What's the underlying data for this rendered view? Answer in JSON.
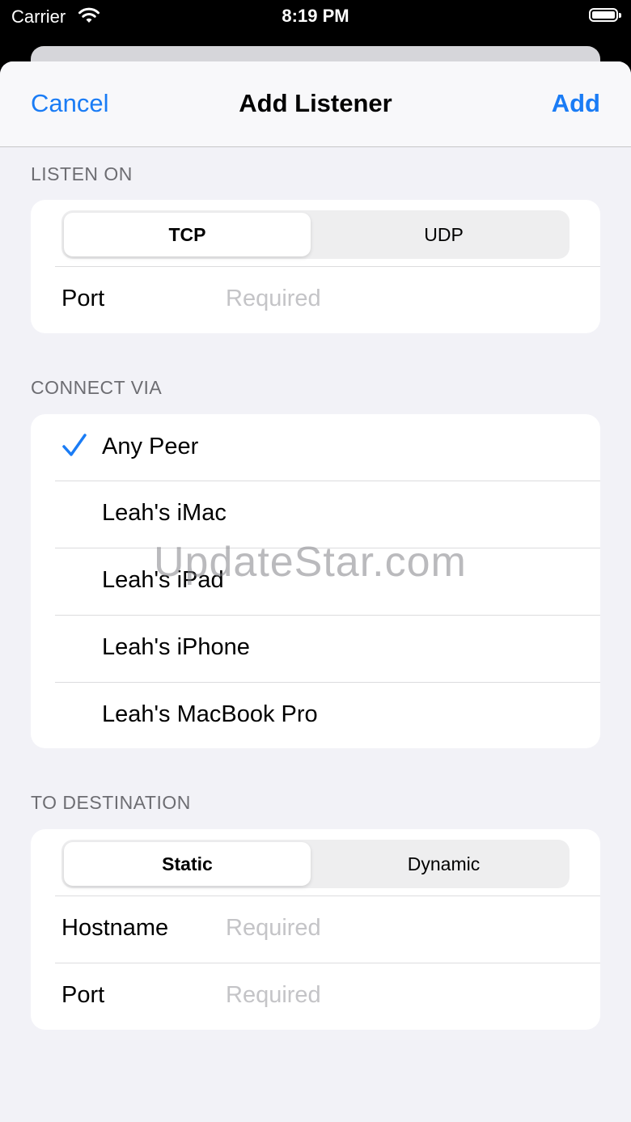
{
  "status_bar": {
    "carrier": "Carrier",
    "time": "8:19 PM"
  },
  "nav": {
    "cancel": "Cancel",
    "title": "Add Listener",
    "add": "Add"
  },
  "listen_on": {
    "header": "LISTEN ON",
    "protocols": [
      "TCP",
      "UDP"
    ],
    "selected": "TCP",
    "port_label": "Port",
    "port_placeholder": "Required",
    "port_value": ""
  },
  "connect_via": {
    "header": "CONNECT VIA",
    "peers": [
      "Any Peer",
      "Leah's iMac",
      "Leah's iPad",
      "Leah's iPhone",
      "Leah's MacBook Pro"
    ],
    "selected": "Any Peer"
  },
  "destination": {
    "header": "TO DESTINATION",
    "modes": [
      "Static",
      "Dynamic"
    ],
    "selected": "Static",
    "hostname_label": "Hostname",
    "hostname_placeholder": "Required",
    "port_label": "Port",
    "port_placeholder": "Required"
  },
  "watermark": "UpdateStar.com",
  "colors": {
    "accent": "#1a7cf5",
    "background": "#f2f2f7",
    "placeholder": "#c4c4c7"
  },
  "icons": {
    "wifi": "wifi-icon",
    "battery": "battery-icon",
    "check": "checkmark-icon"
  }
}
